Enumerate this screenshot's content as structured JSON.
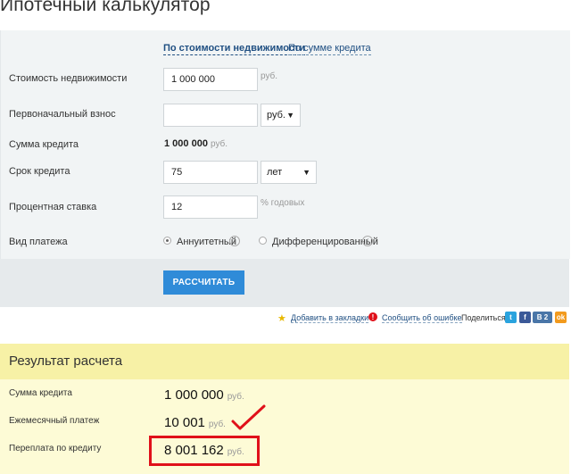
{
  "title": "Ипотечный калькулятор",
  "tabs": [
    {
      "label": "По стоимости недвижимости",
      "active": true
    },
    {
      "label": "По сумме кредита",
      "active": false
    }
  ],
  "form": {
    "price": {
      "label": "Стоимость недвижимости",
      "value": "1 000 000",
      "unit": "руб."
    },
    "down_payment": {
      "label": "Первоначальный взнос",
      "value": "",
      "unit_select": "руб."
    },
    "loan_amount": {
      "label": "Сумма кредита",
      "value": "1 000 000",
      "unit": "руб."
    },
    "term": {
      "label": "Срок кредита",
      "value": "75",
      "unit_select": "лет"
    },
    "rate": {
      "label": "Процентная ставка",
      "value": "12",
      "unit": "% годовых"
    },
    "payment_type": {
      "label": "Вид платежа",
      "options": [
        {
          "label": "Аннуитетный",
          "checked": true
        },
        {
          "label": "Дифференцированный",
          "checked": false
        }
      ]
    },
    "calculate_button": "РАССЧИТАТЬ"
  },
  "toolbar": {
    "bookmark": "Добавить в закладки",
    "report_error": "Сообщить об ошибке",
    "share_label": "Поделиться:",
    "share_icons": [
      "twitter-icon",
      "facebook-icon",
      "vk-icon",
      "odnoklassniki-icon"
    ],
    "vk_count": "2"
  },
  "result": {
    "title": "Результат расчета",
    "rows": [
      {
        "label": "Сумма кредита",
        "value": "1 000 000",
        "unit": "руб."
      },
      {
        "label": "Ежемесячный платеж",
        "value": "10 001",
        "unit": "руб."
      },
      {
        "label": "Переплата по кредиту",
        "value": "8 001 162",
        "unit": "руб."
      }
    ]
  },
  "colors": {
    "accent": "#2f8bd8",
    "highlight": "#e0101a",
    "result_header": "#f7f1a6",
    "result_body": "#fdfbd6"
  }
}
